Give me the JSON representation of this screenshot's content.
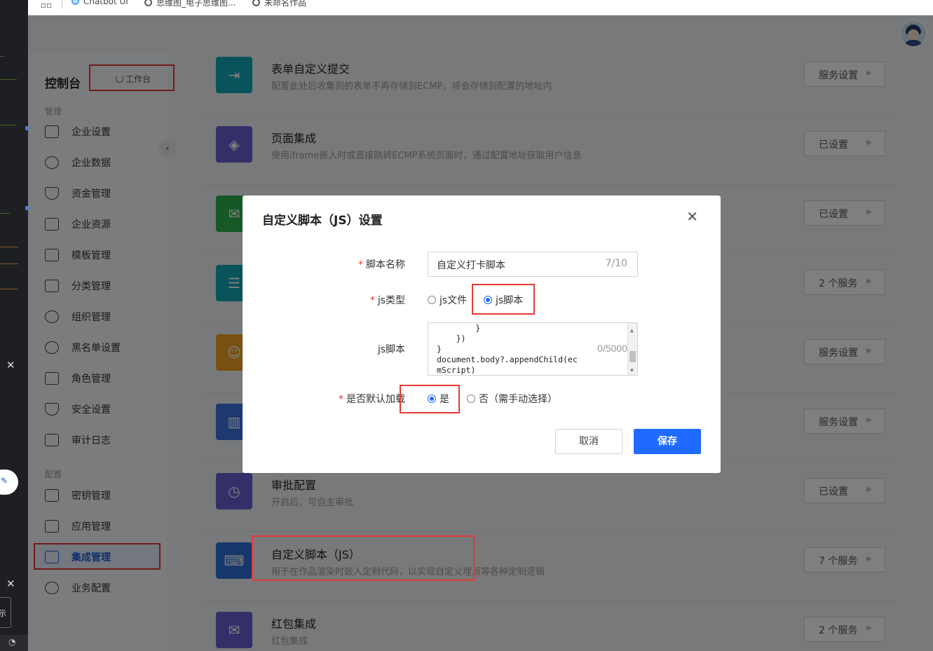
{
  "bookmarks": {
    "items": [
      "Chatbot UI",
      "思维图_电子思维图...",
      "未命名作品"
    ]
  },
  "sidebar": {
    "title": "控制台",
    "workbench_label": "工作台",
    "group_manage": "管理",
    "group_config": "配置",
    "items": [
      {
        "label": "企业设置",
        "icon": "building-icon"
      },
      {
        "label": "企业数据",
        "icon": "pie-chart-icon"
      },
      {
        "label": "资金管理",
        "icon": "yuan-shield-icon"
      },
      {
        "label": "企业资源",
        "icon": "folder-icon"
      },
      {
        "label": "模板管理",
        "icon": "template-icon"
      },
      {
        "label": "分类管理",
        "icon": "tag-icon"
      },
      {
        "label": "组织管理",
        "icon": "users-icon"
      },
      {
        "label": "黑名单设置",
        "icon": "ban-icon"
      },
      {
        "label": "角色管理",
        "icon": "role-icon"
      },
      {
        "label": "安全设置",
        "icon": "shield-icon"
      },
      {
        "label": "审计日志",
        "icon": "clipboard-icon"
      },
      {
        "label": "密钥管理",
        "icon": "key-card-icon"
      },
      {
        "label": "应用管理",
        "icon": "apps-icon"
      },
      {
        "label": "集成管理",
        "icon": "layers-icon"
      },
      {
        "label": "业务配置",
        "icon": "network-icon"
      }
    ]
  },
  "integrations": [
    {
      "title": "表单自定义提交",
      "desc": "配置此处后收集到的表单不再存储到ECMP，将会存储到配置的地址内",
      "button": "服务设置",
      "color": "#13a7b5",
      "icon": "form-submit-icon"
    },
    {
      "title": "页面集成",
      "desc": "使用iframe嵌入时或直接跳转ECMP系统页面时，通过配置地址获取用户信息",
      "button": "已设置",
      "color": "#6b5fd3",
      "icon": "layers-icon"
    },
    {
      "title": "",
      "desc": "",
      "button": "已设置",
      "color": "#2fb14f",
      "icon": "mail-icon"
    },
    {
      "title": "",
      "desc": "",
      "button": "2 个服务",
      "color": "#13a7b5",
      "icon": "clipboard-icon"
    },
    {
      "title": "",
      "desc": "",
      "button": "服务设置",
      "color": "#f0a020",
      "icon": "users-icon"
    },
    {
      "title": "",
      "desc": "",
      "button": "服务设置",
      "color": "#3a73e0",
      "icon": "chart-shield-icon"
    },
    {
      "title": "审批配置",
      "desc": "开启后，可自主审批",
      "button": "已设置",
      "color": "#6b5fd3",
      "icon": "approval-clock-icon"
    },
    {
      "title": "自定义脚本（JS）",
      "desc": "用于在作品渲染时嵌入定制代码，以实现自定义埋点等各种定制逻辑",
      "button": "7 个服务",
      "color": "#2a6fd9",
      "icon": "terminal-icon"
    },
    {
      "title": "红包集成",
      "desc": "红包集成",
      "button": "2 个服务",
      "color": "#6b5fd3",
      "icon": "red-packet-icon"
    }
  ],
  "modal": {
    "title": "自定义脚本（JS）设置",
    "name_label": "脚本名称",
    "name_value": "自定义打卡脚本",
    "name_count": "7/10",
    "type_label": "js类型",
    "type_options": [
      "js文件",
      "js脚本"
    ],
    "type_selected": "js脚本",
    "script_label": "js脚本",
    "script_lines": [
      "        }",
      "    })",
      "}",
      "document.body?.appendChild(ec",
      "mScript)"
    ],
    "script_count": "0/5000",
    "default_label": "是否默认加载",
    "default_options": [
      "是",
      "否（需手动选择）"
    ],
    "default_selected": "是",
    "cancel": "取消",
    "save": "保存"
  },
  "colors": {
    "primary": "#1f6bff",
    "highlight": "#e53935"
  }
}
